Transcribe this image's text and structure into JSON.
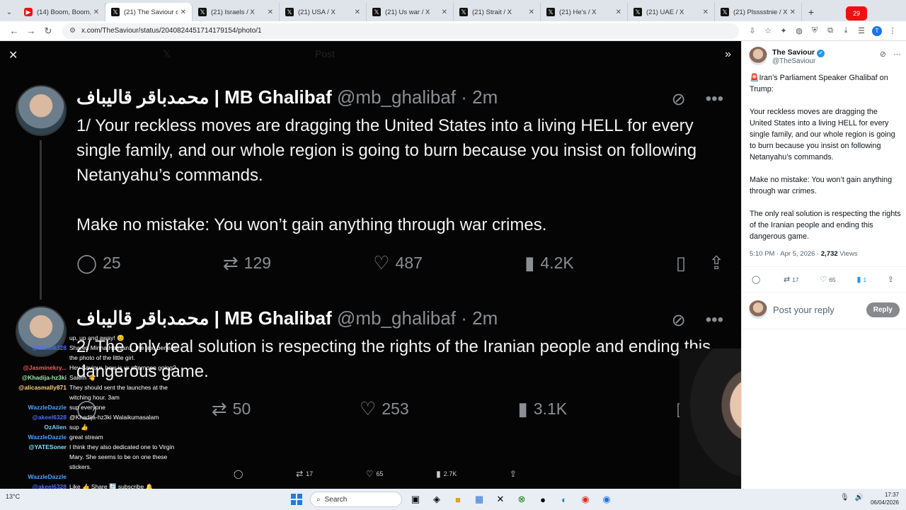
{
  "browser": {
    "tabs": [
      {
        "title": "(14) Boom, Boom, Tel",
        "icon": "youtube"
      },
      {
        "title": "(21) The Saviour on X",
        "icon": "x",
        "active": true
      },
      {
        "title": "(21) Israels / X",
        "icon": "x"
      },
      {
        "title": "(21) USA / X",
        "icon": "x"
      },
      {
        "title": "(21) Us war / X",
        "icon": "x"
      },
      {
        "title": "(21) Strait / X",
        "icon": "x"
      },
      {
        "title": "(21) He's / X",
        "icon": "x"
      },
      {
        "title": "(21) UAE / X",
        "icon": "x"
      },
      {
        "title": "(21) Plsssstnie / X",
        "icon": "x"
      }
    ],
    "url": "x.com/TheSaviour/status/2040824451714179154/photo/1",
    "profile_initial": "T",
    "yt_badge": "29"
  },
  "photo": {
    "header_ghost": "Post",
    "tweets": [
      {
        "name": "محمدباقر قالیباف | MB Ghalibaf",
        "handle": "@mb_ghalibaf · 2m",
        "paragraphs": [
          "1/ Your reckless moves are dragging the United States into a living HELL for every single family, and our whole region is going to burn because you insist on following Netanyahu’s commands.",
          "Make no mistake: You won’t gain anything through war crimes."
        ],
        "replies": "25",
        "reposts": "129",
        "likes": "487",
        "views": "4.2K"
      },
      {
        "name": "محمدباقر قالیباف | MB Ghalibaf",
        "handle": "@mb_ghalibaf · 2m",
        "paragraphs": [
          "2/ The only real solution is respecting the rights of the Iranian people and ending this dangerous game."
        ],
        "replies": "",
        "reposts": "50",
        "likes": "253",
        "views": "3.1K"
      }
    ],
    "bottom_bar": {
      "reposts": "17",
      "likes": "65",
      "views": "2.7K"
    }
  },
  "chat": [
    {
      "user": "",
      "msg": "up, up and away! 😊",
      "color": "#ffffff"
    },
    {
      "user": "@akeel6328",
      "msg": "Shared Minna Hassan... the text beneath the photo of the little girl.",
      "color": "#4f6bff"
    },
    {
      "user": "@Jasminekry...",
      "msg": "Hey Saviour, how is ur afternoon going?",
      "color": "#ff5a5a"
    },
    {
      "user": "@Khadija-hz3ki",
      "msg": "Salem 👋",
      "color": "#9be7a8"
    },
    {
      "user": "@alicasmally871",
      "msg": "They should sent the launches at the witching hour. 3am",
      "color": "#ffd37a"
    },
    {
      "user": "WazzleDazzle",
      "msg": "sup everyone",
      "color": "#4fa3ff"
    },
    {
      "user": "@akeel6328",
      "msg": "@Khadija-hz3ki Walaikumasalam",
      "color": "#4f6bff"
    },
    {
      "user": "OzAlien",
      "msg": "sup 👍",
      "color": "#6fd0ff"
    },
    {
      "user": "WazzleDazzle",
      "msg": "great stream",
      "color": "#4fa3ff"
    },
    {
      "user": "@YATESoner",
      "msg": "I think they also dedicated one to Virgin Mary. She seems to be on one these stickers.",
      "color": "#7fe0ff"
    },
    {
      "user": "WazzleDazzle",
      "msg": "",
      "color": "#4fa3ff"
    },
    {
      "user": "@akeel6328",
      "msg": "Like 👍 Share 🔄 subscribe 🔔",
      "color": "#4f6bff"
    }
  ],
  "side": {
    "author": "The Saviour",
    "handle": "@TheSaviour",
    "paragraphs": [
      "🚨Iran’s Parliament Speaker Ghalibaf on Trump:",
      "Your reckless moves are dragging the United States into a living HELL for every single family, and our whole region is going to burn because you insist on following Netanyahu’s commands.",
      "Make no mistake: You won’t gain anything through war crimes.",
      "The only real solution is respecting the rights of the Iranian people and ending this dangerous game."
    ],
    "time": "5:10 PM · Apr 5, 2026 · ",
    "views_count": "2,732",
    "views_label": " Views",
    "reposts": "17",
    "likes": "65",
    "bookmarks": "1",
    "reply_placeholder": "Post your reply",
    "reply_button": "Reply"
  },
  "taskbar": {
    "search_label": "Search",
    "weather": "13°C",
    "time": "17:37",
    "date": "06/04/2026"
  }
}
